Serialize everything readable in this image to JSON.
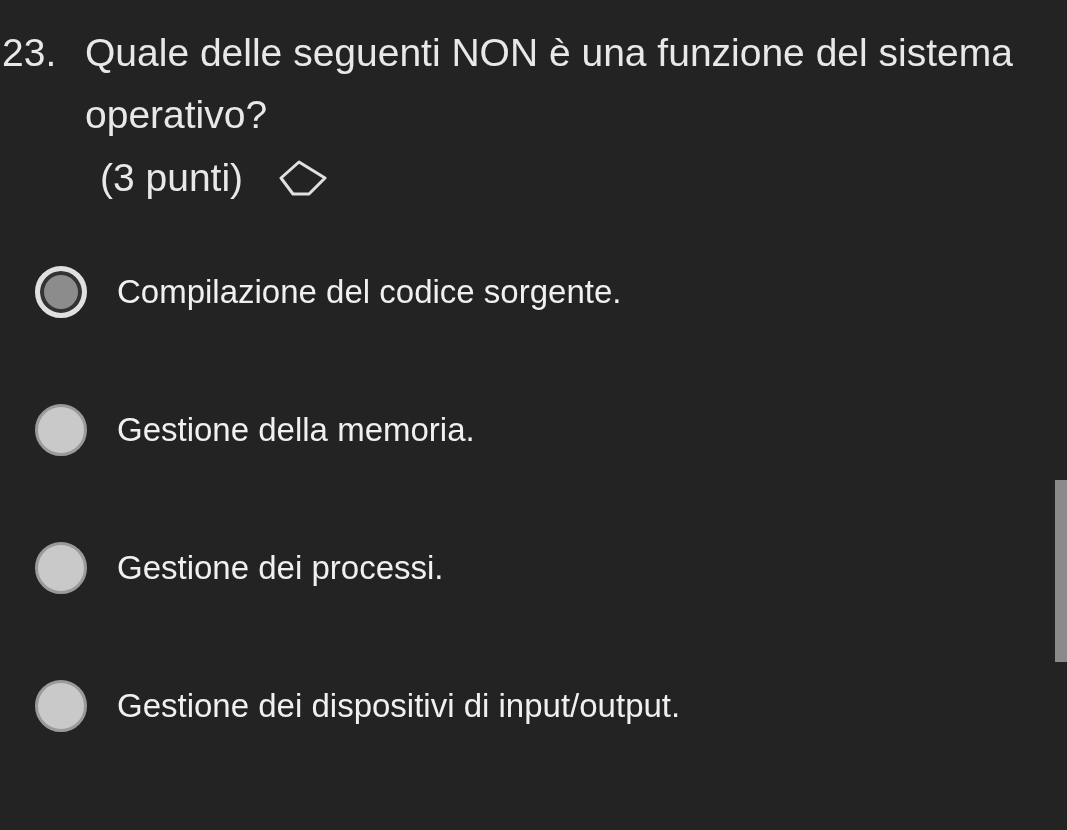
{
  "question": {
    "number": "23.",
    "text": "Quale delle seguenti NON è una funzione del sistema operativo?",
    "points": "(3 punti)"
  },
  "options": [
    {
      "label": "Compilazione del codice sorgente.",
      "selected": true
    },
    {
      "label": "Gestione della memoria.",
      "selected": false
    },
    {
      "label": "Gestione dei processi.",
      "selected": false
    },
    {
      "label": "Gestione dei dispositivi di input/output.",
      "selected": false
    }
  ]
}
